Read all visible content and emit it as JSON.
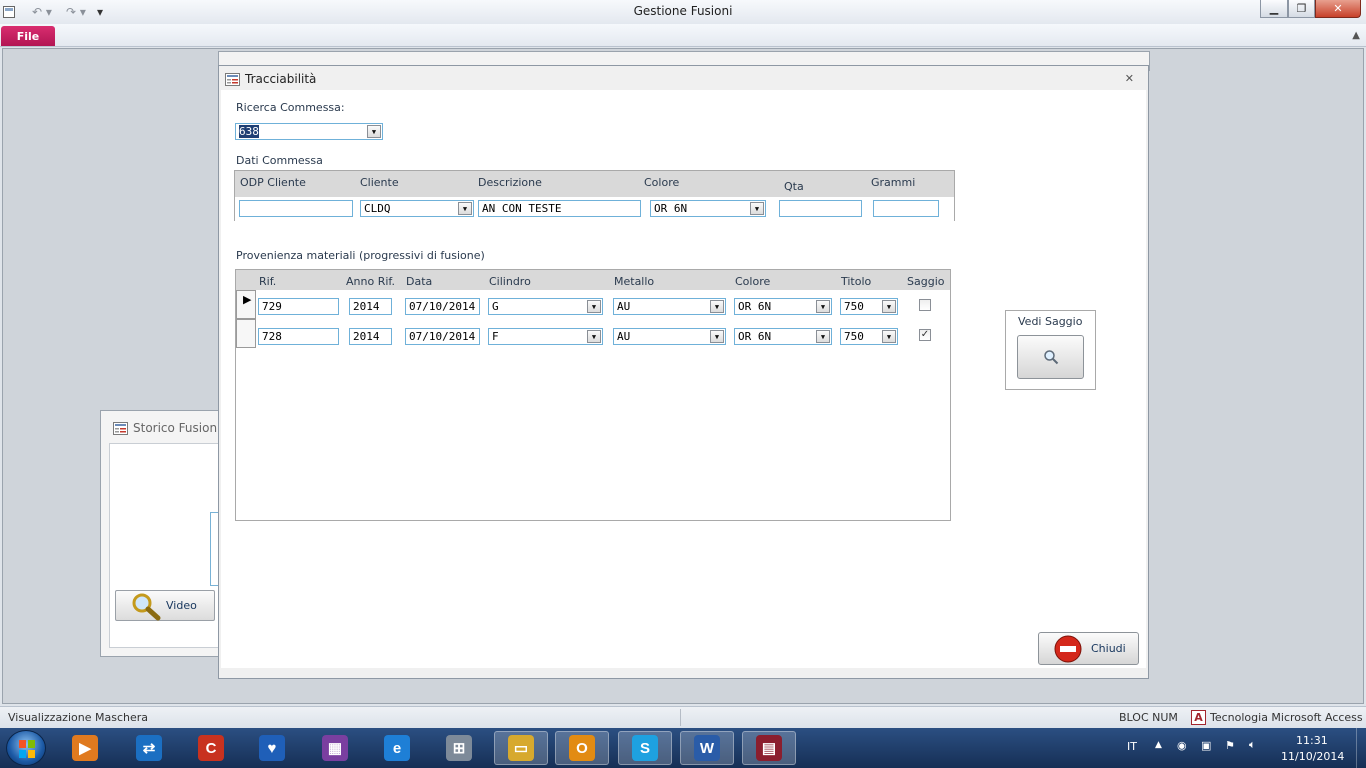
{
  "window": {
    "title": "Gestione Fusioni"
  },
  "ribbon": {
    "file_tab": "File"
  },
  "storico": {
    "title": "Storico Fusioni",
    "video_label": "Video"
  },
  "dialog": {
    "title": "Tracciabilità",
    "ricerca_label": "Ricerca Commessa:",
    "ricerca_value": "638",
    "dati_label": "Dati Commessa",
    "dati_headers": {
      "odp": "ODP Cliente",
      "cliente": "Cliente",
      "descrizione": "Descrizione",
      "colore": "Colore",
      "qta": "Qta",
      "grammi": "Grammi"
    },
    "dati_values": {
      "odp": "",
      "cliente": "CLDQ",
      "descrizione": "AN CON TESTE",
      "colore": "OR 6N",
      "qta": "",
      "grammi": ""
    },
    "prov_label": "Provenienza materiali (progressivi di fusione)",
    "prov_headers": {
      "rif": "Rif.",
      "anno": "Anno Rif.",
      "data": "Data",
      "cilindro": "Cilindro",
      "metallo": "Metallo",
      "colore": "Colore",
      "titolo": "Titolo",
      "saggio": "Saggio"
    },
    "rows": [
      {
        "rif": "729",
        "anno": "2014",
        "data": "07/10/2014",
        "cilindro": "G",
        "metallo": "AU",
        "colore": "OR 6N",
        "titolo": "750",
        "saggio": false
      },
      {
        "rif": "728",
        "anno": "2014",
        "data": "07/10/2014",
        "cilindro": "F",
        "metallo": "AU",
        "colore": "OR 6N",
        "titolo": "750",
        "saggio": true
      }
    ],
    "vedi_saggio_label": "Vedi Saggio",
    "chiudi_label": "Chiudi"
  },
  "statusbar": {
    "left": "Visualizzazione Maschera",
    "numlock": "BLOC NUM",
    "tech": "Tecnologia Microsoft Access"
  },
  "taskbar": {
    "language": "IT",
    "time": "11:31",
    "date": "11/10/2014",
    "apps": [
      {
        "icon": "media-player-icon",
        "glyph": "▶",
        "color": "#e07a1f"
      },
      {
        "icon": "teamviewer-icon",
        "glyph": "⇄",
        "color": "#1b6fc2"
      },
      {
        "icon": "ccleaner-icon",
        "glyph": "C",
        "color": "#c8321f"
      },
      {
        "icon": "shield-icon",
        "glyph": "♥",
        "color": "#1f5fb8"
      },
      {
        "icon": "winrar-icon",
        "glyph": "▦",
        "color": "#7a3fa0"
      },
      {
        "icon": "internet-explorer-icon",
        "glyph": "e",
        "color": "#1e7fd6"
      },
      {
        "icon": "calculator-icon",
        "glyph": "⊞",
        "color": "#7d8a99"
      },
      {
        "icon": "explorer-folder-icon",
        "glyph": "▭",
        "color": "#d7a92e"
      },
      {
        "icon": "outlook-icon",
        "glyph": "O",
        "color": "#e28b12"
      },
      {
        "icon": "skype-icon",
        "glyph": "S",
        "color": "#1ea1e0"
      },
      {
        "icon": "word-icon",
        "glyph": "W",
        "color": "#2a5ca8"
      },
      {
        "icon": "access-form-icon",
        "glyph": "▤",
        "color": "#8b1e2e"
      }
    ]
  }
}
